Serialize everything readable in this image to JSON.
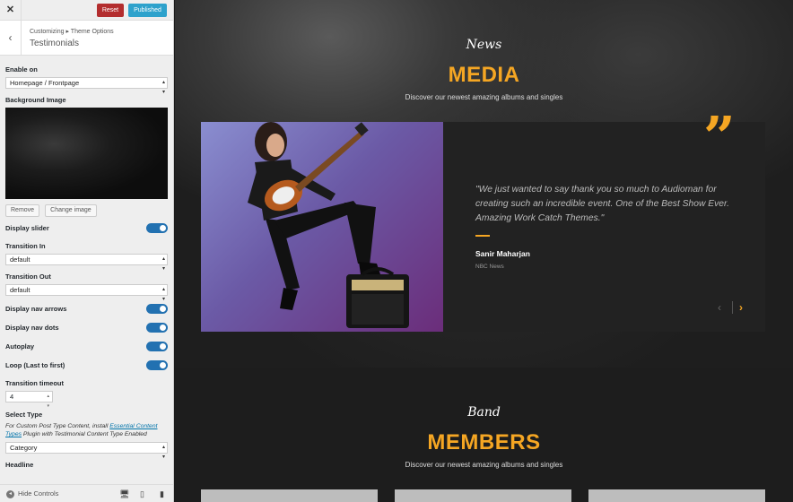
{
  "topbar": {
    "close_label": "✕",
    "reset_label": "Reset",
    "publish_label": "Published"
  },
  "section": {
    "breadcrumb": "Customizing ▸ Theme Options",
    "title": "Testimonials",
    "back_icon": "‹"
  },
  "controls": {
    "enable_on": {
      "label": "Enable on",
      "value": "Homepage / Frontpage"
    },
    "background_image": {
      "label": "Background Image",
      "remove_label": "Remove",
      "change_label": "Change image"
    },
    "display_slider": {
      "label": "Display slider",
      "on": true
    },
    "transition_in": {
      "label": "Transition In",
      "value": "default"
    },
    "transition_out": {
      "label": "Transition Out",
      "value": "default"
    },
    "display_nav_arrows": {
      "label": "Display nav arrows",
      "on": true
    },
    "display_nav_dots": {
      "label": "Display nav dots",
      "on": true
    },
    "autoplay": {
      "label": "Autoplay",
      "on": true
    },
    "loop": {
      "label": "Loop (Last to first)",
      "on": true
    },
    "transition_timeout": {
      "label": "Transition timeout",
      "value": "4"
    },
    "select_type": {
      "label": "Select Type",
      "desc_before": "For Custom Post Type Content, install ",
      "desc_link": "Essential Content Types",
      "desc_after": " Plugin with Testimonial Content Type Enabled",
      "value": "Category"
    },
    "headline": {
      "label": "Headline"
    }
  },
  "footer": {
    "hide_controls_label": "Hide Controls",
    "devices": [
      "desktop-icon",
      "tablet-icon",
      "mobile-icon"
    ]
  },
  "preview": {
    "media": {
      "script": "News",
      "title": "MEDIA",
      "subtitle": "Discover our newest amazing albums and singles"
    },
    "testimonial": {
      "quote_mark": "”",
      "quote": "\"We just wanted to say thank you so much to Audioman for creating such an incredible event. One of the Best Show Ever. Amazing Work Catch Themes.\"",
      "name": "Sanir Maharjan",
      "organization": "NBC News",
      "prev_icon": "‹",
      "next_icon": "›"
    },
    "members": {
      "script": "Band",
      "title": "MEMBERS",
      "subtitle": "Discover our newest amazing albums and singles"
    }
  },
  "colors": {
    "accent": "#f5a623",
    "toggle_on": "#2271b1",
    "reset": "#b32d2e",
    "publish": "#2ea2cc"
  }
}
